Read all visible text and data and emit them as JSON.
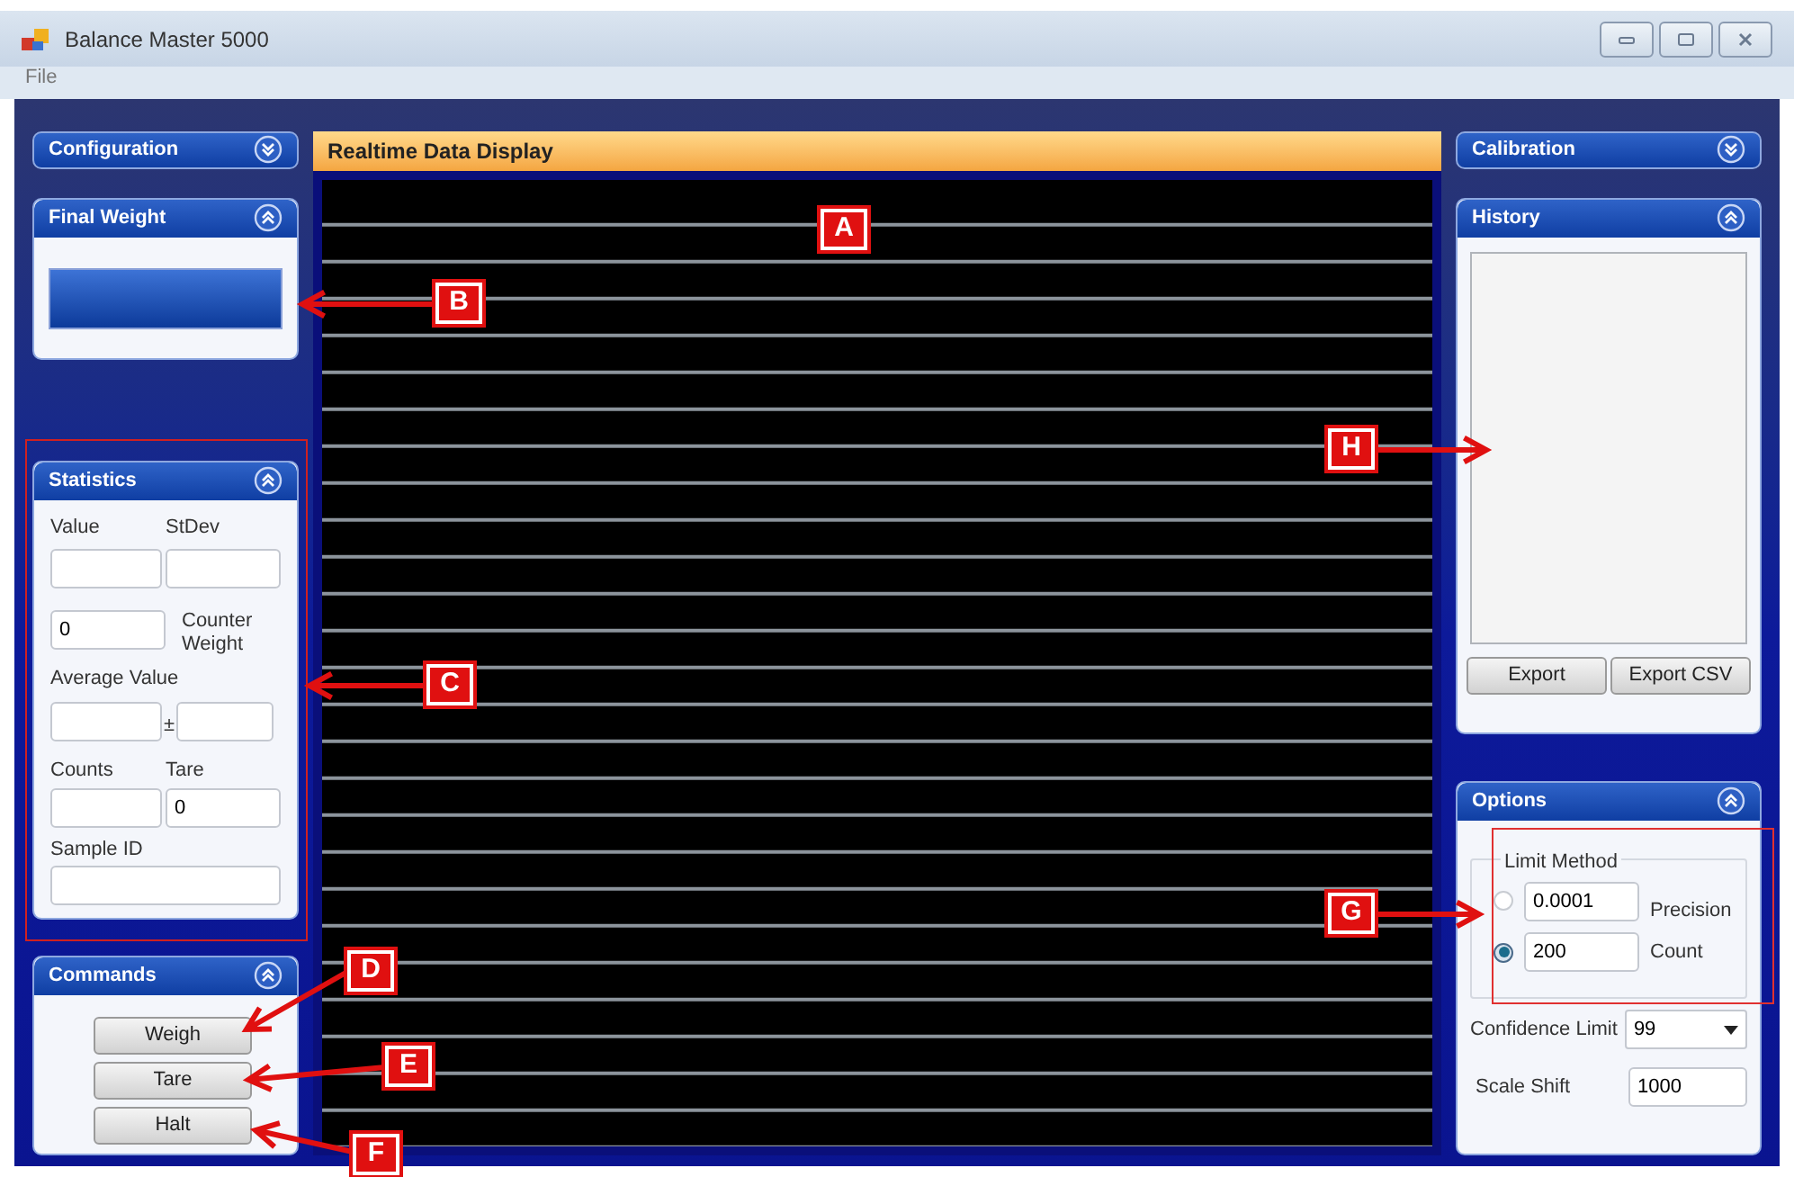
{
  "window": {
    "title": "Balance Master 5000"
  },
  "menu": [
    "File"
  ],
  "left_panels": {
    "configuration": {
      "title": "Configuration",
      "expanded": false
    },
    "final_weight": {
      "title": "Final Weight",
      "expanded": true
    },
    "statistics": {
      "title": "Statistics",
      "expanded": true,
      "value_label": "Value",
      "stdev_label": "StDev",
      "counter_weight": "0",
      "counter_weight_label": "Counter Weight",
      "average_label": "Average Value",
      "plus_minus": "±",
      "counts_label": "Counts",
      "tare_label": "Tare",
      "tare": "0",
      "sample_id_label": "Sample ID"
    },
    "commands": {
      "title": "Commands",
      "expanded": true,
      "buttons": [
        "Weigh",
        "Tare",
        "Halt"
      ]
    }
  },
  "display": {
    "title": "Realtime Data Display"
  },
  "right_panels": {
    "calibration": {
      "title": "Calibration",
      "expanded": false
    },
    "history": {
      "title": "History",
      "expanded": true,
      "buttons": [
        "Export",
        "Export CSV"
      ]
    },
    "options": {
      "title": "Options",
      "expanded": true,
      "group_title": "Limit Method",
      "limits": [
        {
          "value": "0.0001",
          "label": "Precision",
          "selected": false
        },
        {
          "value": "200",
          "label": "Count",
          "selected": true
        }
      ],
      "confidence_label": "Confidence Limit",
      "confidence": "99",
      "scale_shift_label": "Scale Shift",
      "scale_shift": "1000"
    }
  },
  "annotations": [
    {
      "label": "A"
    },
    {
      "label": "B"
    },
    {
      "label": "C"
    },
    {
      "label": "D"
    },
    {
      "label": "E"
    },
    {
      "label": "F"
    },
    {
      "label": "G"
    },
    {
      "label": "H"
    }
  ]
}
